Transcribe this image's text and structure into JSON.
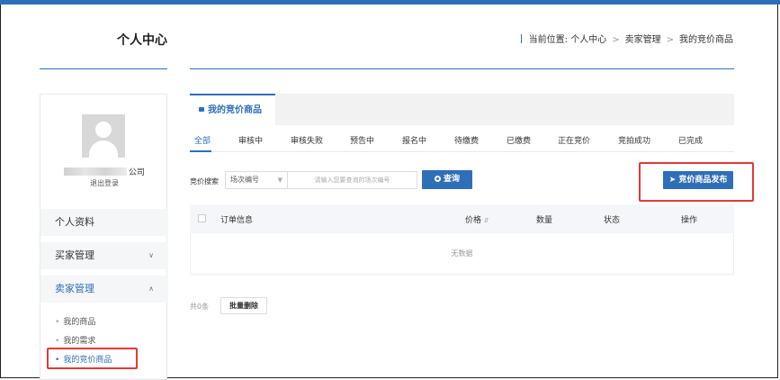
{
  "header": {
    "site_title": "个人中心",
    "breadcrumb_prefix": "当前位置:",
    "breadcrumb": [
      "个人中心",
      "卖家管理",
      "我的竞价商品"
    ]
  },
  "sidebar": {
    "company_suffix": "公司",
    "logout": "退出登录",
    "menu": [
      {
        "label": "个人资料"
      },
      {
        "label": "买家管理",
        "icon": "chevron-down-icon"
      },
      {
        "label": "卖家管理",
        "icon": "chevron-up-icon"
      }
    ],
    "submenu": [
      {
        "label": "我的商品"
      },
      {
        "label": "我的需求"
      },
      {
        "label": "我的竞价商品"
      }
    ]
  },
  "main": {
    "tab": "我的竞价商品",
    "status_tabs": [
      "全部",
      "审核中",
      "审核失败",
      "预告中",
      "报名中",
      "待缴费",
      "已缴费",
      "正在竞价",
      "竞拍成功",
      "已完成"
    ],
    "search": {
      "label": "竞价搜索",
      "select_value": "场次编号",
      "placeholder": "请输入您要查询的场次编号",
      "button": "查询"
    },
    "publish_button": "竞价商品发布",
    "table": {
      "columns": [
        "订单信息",
        "价格",
        "数量",
        "状态",
        "操作"
      ],
      "empty_text": "无数据"
    },
    "footer": {
      "total": "共0条",
      "batch_delete": "批量删除"
    }
  },
  "colors": {
    "accent": "#2f6fb7",
    "highlight_box": "#e03a3a"
  }
}
